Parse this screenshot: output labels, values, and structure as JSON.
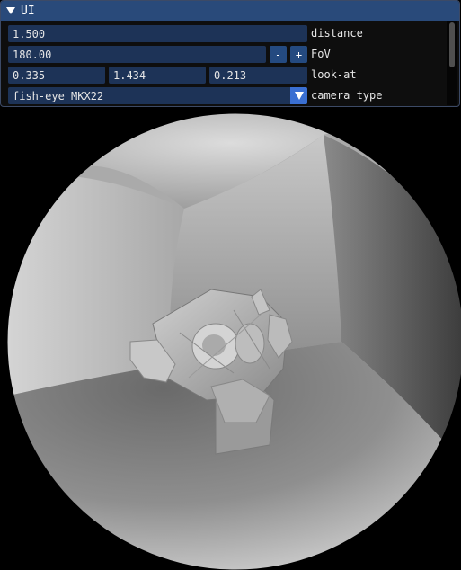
{
  "window": {
    "title": "UI",
    "collapse_icon": "triangle-down"
  },
  "controls": {
    "distance": {
      "value": "1.500",
      "label": "distance"
    },
    "fov": {
      "value": "180.00",
      "minus_label": "-",
      "plus_label": "+",
      "label": "FoV"
    },
    "look_at": {
      "x": "0.335",
      "y": "1.434",
      "z": "0.213",
      "label": "look-at"
    },
    "camera_type": {
      "value": "fish-eye MKX22",
      "label": "camera type",
      "dropdown_icon": "triangle-down"
    }
  },
  "colors": {
    "window_bg": "#0f0f0f",
    "titlebar": "#294a7a",
    "field_bg": "#1d3357",
    "button_bg": "#244a80",
    "combo_arrow": "#3a6fd2",
    "text": "#e6e6e6"
  }
}
